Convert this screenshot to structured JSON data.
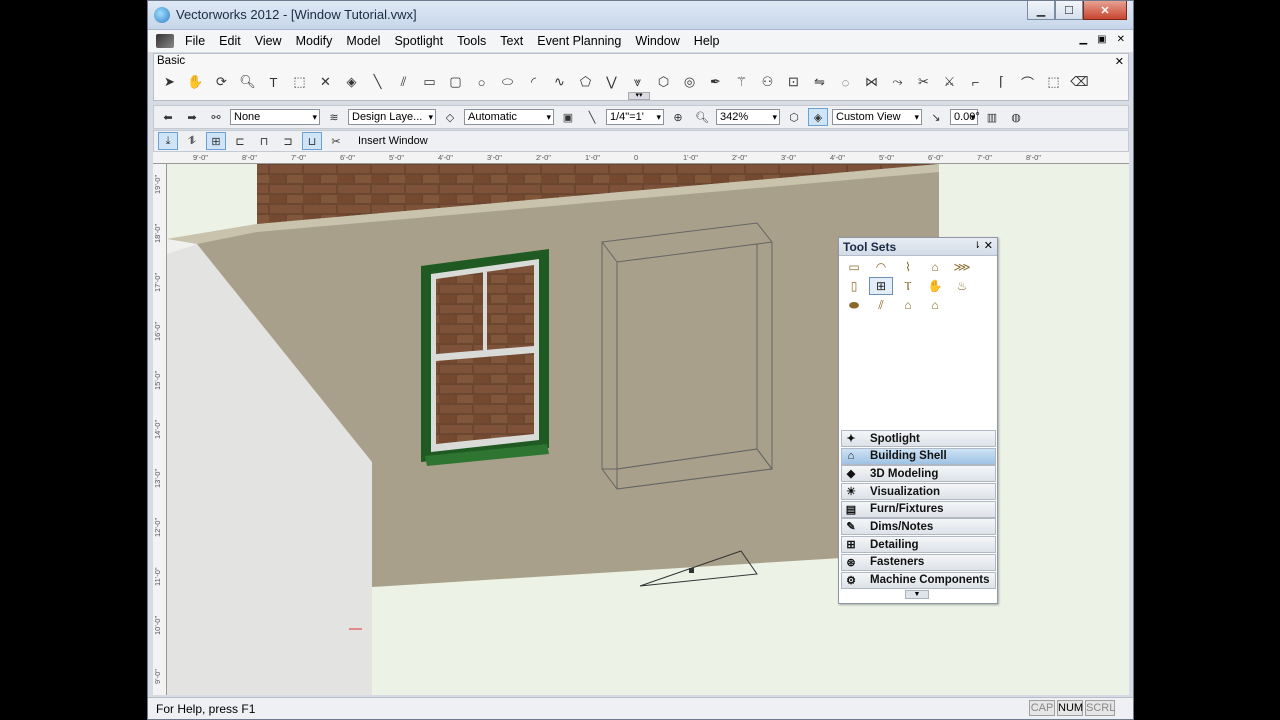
{
  "window": {
    "title": "Vectorworks 2012 - [Window Tutorial.vwx]",
    "controls": {
      "minimize": "▁",
      "maximize": "☐",
      "close": "✕"
    }
  },
  "menu": {
    "items": [
      "File",
      "Edit",
      "View",
      "Modify",
      "Model",
      "Spotlight",
      "Tools",
      "Text",
      "Event Planning",
      "Window",
      "Help"
    ],
    "mdi_controls": [
      "▁",
      "▣",
      "✕"
    ]
  },
  "basic_palette": {
    "title": "Basic",
    "close": "✕",
    "tools": [
      "arrow-icon",
      "pan-icon",
      "flyover-icon",
      "zoom-icon",
      "text-icon",
      "callout-icon",
      "x-icon",
      "attributes-icon",
      "line-icon",
      "double-line-icon",
      "rectangle-icon",
      "rounded-rect-icon",
      "circle-icon",
      "oval-icon",
      "arc-icon",
      "freehand-icon",
      "polygon-icon",
      "polyline-icon",
      "double-polyline-icon",
      "regular-polygon-icon",
      "spiral-icon",
      "eyedropper-icon",
      "wand-icon",
      "walkthrough-icon",
      "rotate-icon",
      "mirror-icon",
      "clip-icon",
      "fillet-icon",
      "offset-icon",
      "trim-icon",
      "split-icon",
      "chamfer-icon",
      "connect-icon",
      "reshape-icon",
      "curve-icon",
      "eraser-icon"
    ]
  },
  "view_bar": {
    "class": "None",
    "layer": "Design Laye...",
    "render": "Automatic",
    "scale": "1/4\"=1'",
    "zoom": "342%",
    "view": "Custom View",
    "angle": "0.00°"
  },
  "mode_bar": {
    "label": "Insert Window"
  },
  "rulers": {
    "horizontal": [
      "9'-0\"",
      "8'-0\"",
      "7'-0\"",
      "6'-0\"",
      "5'-0\"",
      "4'-0\"",
      "3'-0\"",
      "2'-0\"",
      "1'-0\"",
      "0",
      "1'-0\"",
      "2'-0\"",
      "3'-0\"",
      "4'-0\"",
      "5'-0\"",
      "6'-0\"",
      "7'-0\"",
      "8'-0\""
    ],
    "vertical": [
      "19'-0\"",
      "18'-0\"",
      "17'-0\"",
      "16'-0\"",
      "15'-0\"",
      "14'-0\"",
      "13'-0\"",
      "12'-0\"",
      "11'-0\"",
      "10'-0\"",
      "9'-0\""
    ]
  },
  "tool_sets": {
    "title": "Tool Sets",
    "pin": "⇂",
    "close": "✕",
    "sets": [
      {
        "label": "Spotlight",
        "icon": "spotlight-icon",
        "glyph": "✦"
      },
      {
        "label": "Building Shell",
        "icon": "building-shell-icon",
        "glyph": "⌂",
        "active": true
      },
      {
        "label": "3D Modeling",
        "icon": "modeling-icon",
        "glyph": "◆"
      },
      {
        "label": "Visualization",
        "icon": "visualization-icon",
        "glyph": "☀"
      },
      {
        "label": "Furn/Fixtures",
        "icon": "furniture-icon",
        "glyph": "▤"
      },
      {
        "label": "Dims/Notes",
        "icon": "dims-icon",
        "glyph": "✎"
      },
      {
        "label": "Detailing",
        "icon": "detailing-icon",
        "glyph": "⊞"
      },
      {
        "label": "Fasteners",
        "icon": "fasteners-icon",
        "glyph": "⊛"
      },
      {
        "label": "Machine Components",
        "icon": "gear-icon",
        "glyph": "⚙"
      }
    ]
  },
  "status_bar": {
    "help": "For Help, press F1",
    "keys": [
      "CAP",
      "NUM",
      "SCRL"
    ]
  },
  "colors": {
    "wall": "#a8a08a",
    "window_frame": "#1f5a22",
    "brick": "#6b4630",
    "ground": "#edf2e6"
  }
}
